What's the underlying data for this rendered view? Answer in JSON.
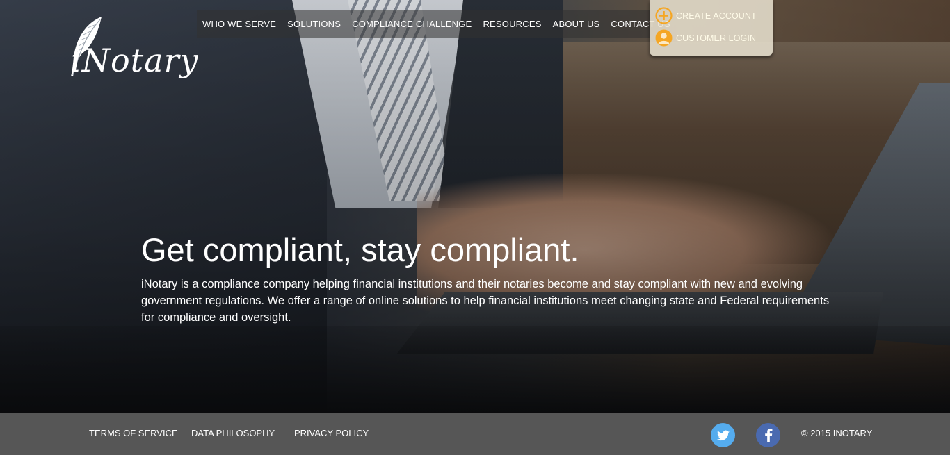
{
  "logo": {
    "text": "iNotary"
  },
  "nav": {
    "items": [
      {
        "label": "WHO WE SERVE"
      },
      {
        "label": "SOLUTIONS"
      },
      {
        "label": "COMPLIANCE CHALLENGE"
      },
      {
        "label": "RESOURCES"
      },
      {
        "label": "ABOUT US"
      },
      {
        "label": "CONTACT US"
      }
    ]
  },
  "account": {
    "create_label": "CREATE ACCOUNT",
    "login_label": "CUSTOMER LOGIN",
    "icon_color": "#f5a623"
  },
  "hero": {
    "title": "Get compliant, stay compliant.",
    "body": "iNotary is a compliance company helping financial institutions and their notaries become and stay compliant with new and evolving government regulations. We offer a range of online solutions to help financial institutions meet changing state and Federal requirements for compliance and oversight."
  },
  "footer": {
    "links": [
      {
        "label": "TERMS OF SERVICE"
      },
      {
        "label": "DATA PHILOSOPHY"
      },
      {
        "label": "PRIVACY POLICY"
      }
    ],
    "twitter_color": "#55acee",
    "facebook_color": "#3b5998",
    "copyright": "© 2015 INOTARY"
  }
}
